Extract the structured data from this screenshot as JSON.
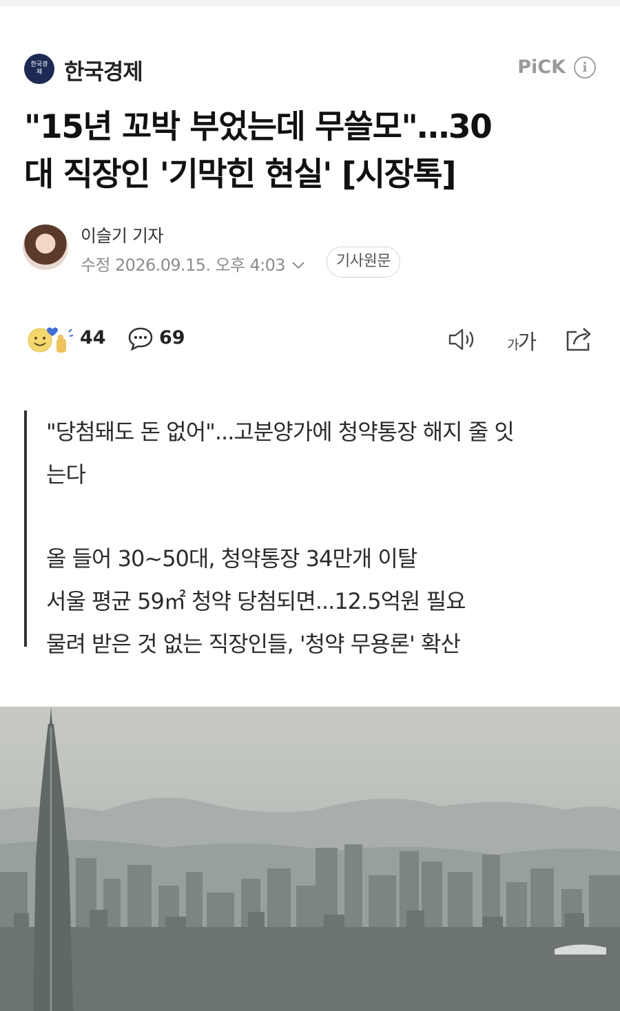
{
  "press": {
    "logo_text": "한국경제",
    "name": "한국경제",
    "pick_label": "PiCK",
    "info_icon": "info-icon"
  },
  "article": {
    "headline_line1": "\"15년 꼬박 부었는데 무쓸모\"…30",
    "headline_line2": "대 직장인 '기막힌 현실' [시장톡]"
  },
  "byline": {
    "reporter": "이슬기 기자",
    "modified": "수정 2026.09.15. 오후 4:03",
    "original_button": "기사원문"
  },
  "actions": {
    "reaction_count": "44",
    "comment_count": "69",
    "font_small": "가",
    "font_large": "가",
    "icons": [
      "reaction-icon",
      "comment-icon",
      "speaker-icon",
      "font-size-icon",
      "share-icon"
    ]
  },
  "summary": {
    "line1": "\"당첨돼도 돈 없어\"...고분양가에 청약통장 해지 줄 잇",
    "line2": "는다",
    "line3": "올 들어 30~50대, 청약통장 34만개 이탈",
    "line4": "서울 평균 59㎡ 청약 당첨되면...12.5억원 필요",
    "line5": "물려 받은 것 없는 직장인들, '청약 무용론' 확산"
  },
  "colors": {
    "press_logo_bg": "#1d2b54",
    "muted_text": "#8c8c8c",
    "pick_gray": "#9a9a9a"
  }
}
